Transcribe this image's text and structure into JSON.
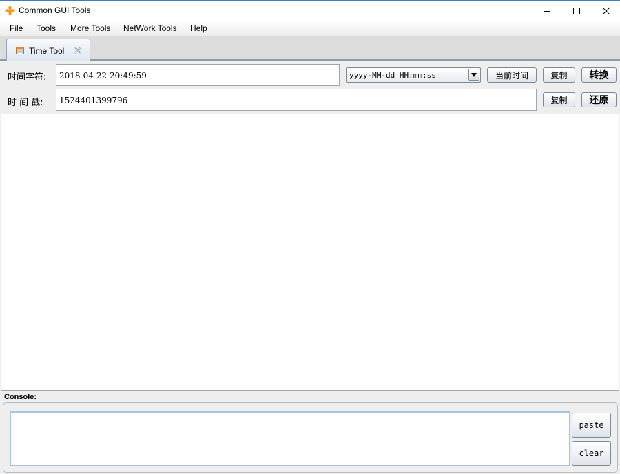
{
  "window": {
    "title": "Common GUI Tools",
    "app_icon": "orange-asterisk-icon",
    "controls": [
      "minimize-icon",
      "maximize-icon",
      "close-icon"
    ]
  },
  "menu": {
    "items": [
      "File",
      "Tools",
      "More Tools",
      "NetWork Tools",
      "Help"
    ]
  },
  "tabs": [
    {
      "label": "Time Tool",
      "icon": "calendar-icon",
      "close_icon": "tab-close-icon",
      "active": true
    }
  ],
  "time_string_row": {
    "label": "时间字符:",
    "value": "2018-04-22 20:49:59",
    "format_select": "yyyy-MM-dd HH:mm:ss",
    "now_button": "当前时间",
    "copy_button": "复制",
    "convert_button": "转换"
  },
  "timestamp_row": {
    "label": "时 间 戳:",
    "value": "1524401399796",
    "copy_button": "复制",
    "restore_button": "还原"
  },
  "console": {
    "label": "Console:",
    "text": "",
    "paste_button": "paste",
    "clear_button": "clear"
  },
  "colors": {
    "accent": "#3c7fb1",
    "tab_fill": "#dfe7f1",
    "console_focus_border": "#a7c3e0",
    "icon_orange": "#f39c1f"
  }
}
